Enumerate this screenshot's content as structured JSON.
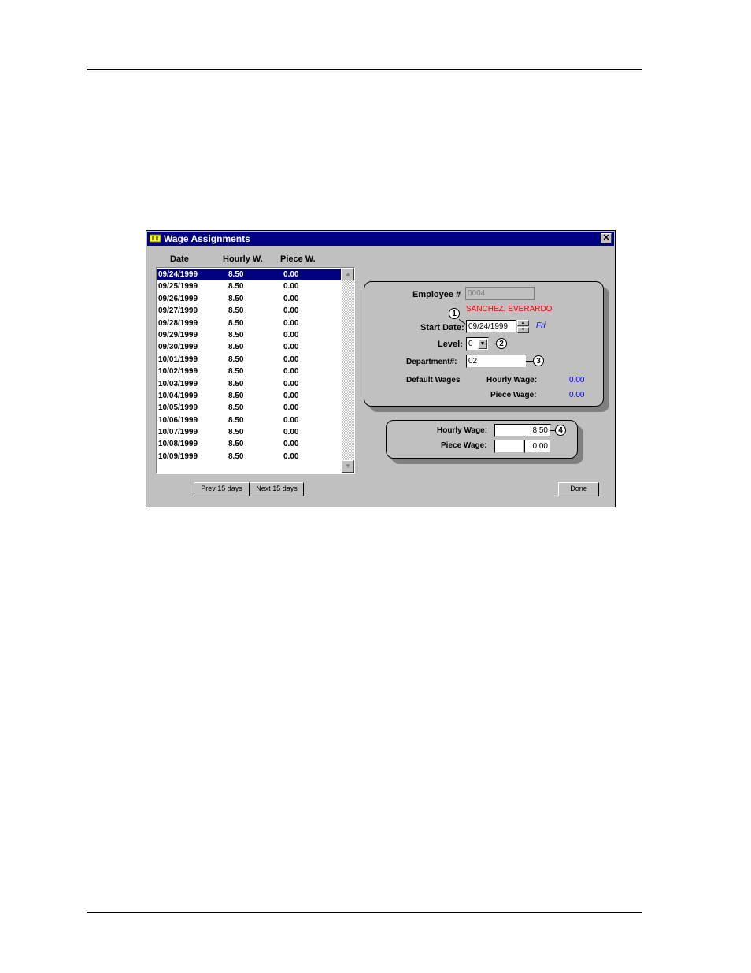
{
  "window": {
    "title": "Wage Assignments",
    "close_glyph": "✕"
  },
  "list": {
    "headers": [
      "Date",
      "Hourly W.",
      "Piece W."
    ],
    "rows": [
      [
        "09/24/1999",
        "8.50",
        "0.00"
      ],
      [
        "09/25/1999",
        "8.50",
        "0.00"
      ],
      [
        "09/26/1999",
        "8.50",
        "0.00"
      ],
      [
        "09/27/1999",
        "8.50",
        "0.00"
      ],
      [
        "09/28/1999",
        "8.50",
        "0.00"
      ],
      [
        "09/29/1999",
        "8.50",
        "0.00"
      ],
      [
        "09/30/1999",
        "8.50",
        "0.00"
      ],
      [
        "10/01/1999",
        "8.50",
        "0.00"
      ],
      [
        "10/02/1999",
        "8.50",
        "0.00"
      ],
      [
        "10/03/1999",
        "8.50",
        "0.00"
      ],
      [
        "10/04/1999",
        "8.50",
        "0.00"
      ],
      [
        "10/05/1999",
        "8.50",
        "0.00"
      ],
      [
        "10/06/1999",
        "8.50",
        "0.00"
      ],
      [
        "10/07/1999",
        "8.50",
        "0.00"
      ],
      [
        "10/08/1999",
        "8.50",
        "0.00"
      ],
      [
        "10/09/1999",
        "8.50",
        "0.00"
      ]
    ],
    "selected_index": 0
  },
  "buttons": {
    "prev": "Prev 15 days",
    "next": "Next 15 days",
    "done": "Done"
  },
  "employee": {
    "label": "Employee #",
    "value": "0004",
    "name": "SANCHEZ, EVERARDO",
    "start_date_label": "Start Date:",
    "start_date": "09/24/1999",
    "weekday": "Fri",
    "level_label": "Level:",
    "level": "0",
    "department_label": "Department#:",
    "department": "02",
    "default_wages_label": "Default Wages",
    "default_hourly_label": "Hourly Wage:",
    "default_hourly": "0.00",
    "default_piece_label": "Piece Wage:",
    "default_piece": "0.00"
  },
  "wage": {
    "hourly_label": "Hourly Wage:",
    "hourly": "8.50",
    "piece_label": "Piece Wage:",
    "piece": "0.00"
  },
  "callouts": [
    "1",
    "2",
    "3",
    "4"
  ],
  "colors": {
    "title_bar": "#000080",
    "name": "#ff0000",
    "info": "#0000ff",
    "face": "#c0c0c0"
  }
}
